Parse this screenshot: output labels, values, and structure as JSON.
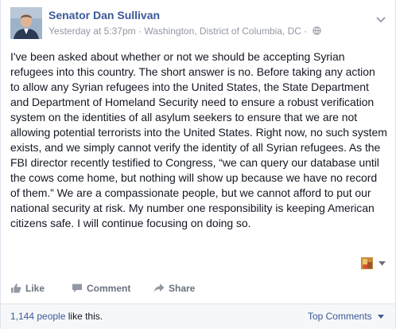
{
  "post": {
    "author": "Senator Dan Sullivan",
    "timestamp": "Yesterday at 5:37pm",
    "separator": "·",
    "location": "Washington, District of Columbia, DC",
    "separator2": "·",
    "audience_icon": "globe-icon",
    "options_icon": "chevron-down-icon",
    "body": "I've been asked about whether or not we should be accepting Syrian refugees into this country. The short answer is no. Before taking any action to allow any Syrian refugees into the United States, the State Department and Department of Homeland Security need to ensure a robust verification system on the identities of all asylum seekers to ensure that we are not allowing potential terrorists into the United States. Right now, no such system exists, and we simply cannot verify the identity of all Syrian refugees. As the FBI director recently testified to Congress, “we can query our database until the cows come home, but nothing will show up because we have no record of them.” We are a compassionate people, but we cannot afford to put our national security at risk. My number one responsibility is keeping American citizens safe. I will continue focusing on doing so."
  },
  "actions": {
    "like": "Like",
    "comment": "Comment",
    "share": "Share",
    "like_icon": "thumbs-up-icon",
    "comment_icon": "comment-bubble-icon",
    "share_icon": "share-arrow-icon"
  },
  "footer": {
    "like_count": "1,144 people",
    "like_suffix": " like this.",
    "top_comments": "Top Comments"
  },
  "colors": {
    "link_blue": "#3b5998",
    "meta_gray": "#9197a3",
    "footer_bg": "#f6f7f9"
  }
}
